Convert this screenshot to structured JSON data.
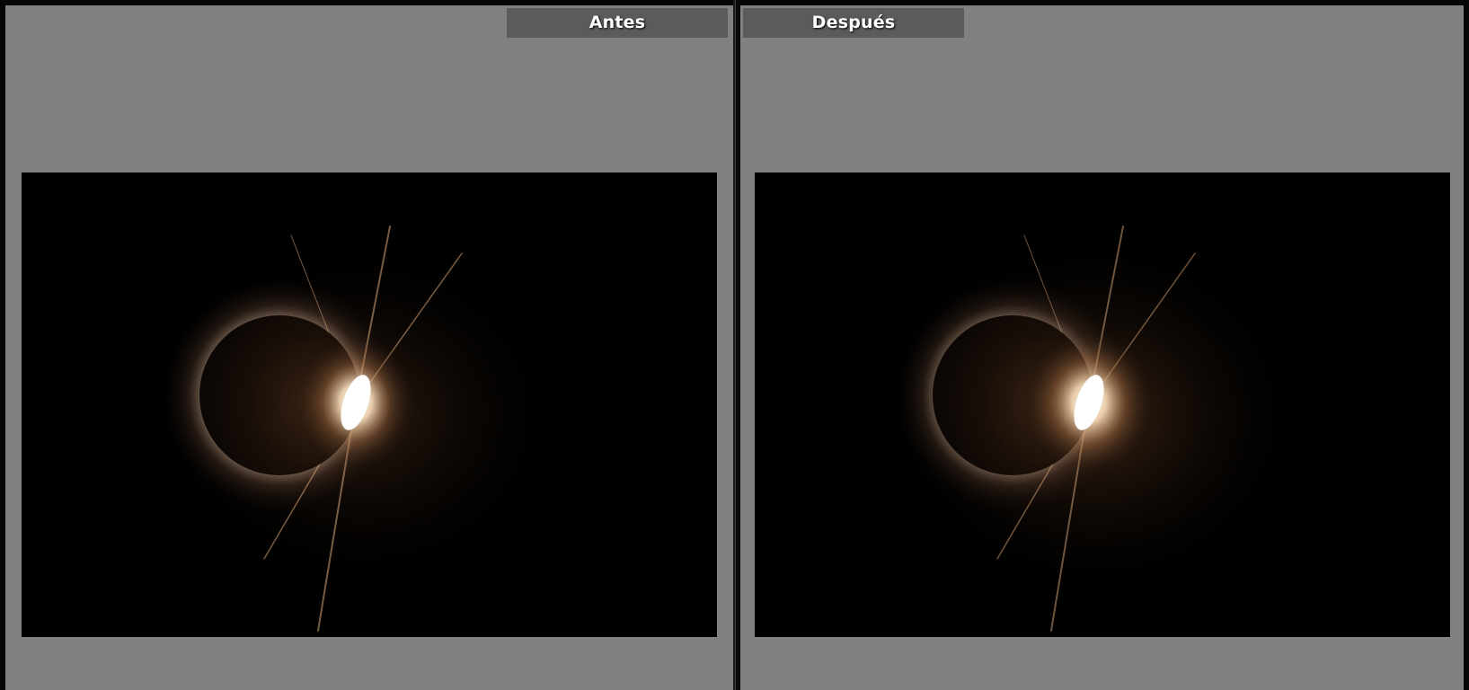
{
  "compare_view": {
    "before": {
      "label": "Antes",
      "photo_subject": "solar-eclipse-diamond-ring"
    },
    "after": {
      "label": "Después",
      "photo_subject": "solar-eclipse-diamond-ring"
    }
  },
  "colors": {
    "panel_background": "#818181",
    "label_tab_background": "#5b5b5b",
    "frame_dark": "#060606",
    "photo_background": "#000000",
    "corona_warm": "#c89060"
  }
}
